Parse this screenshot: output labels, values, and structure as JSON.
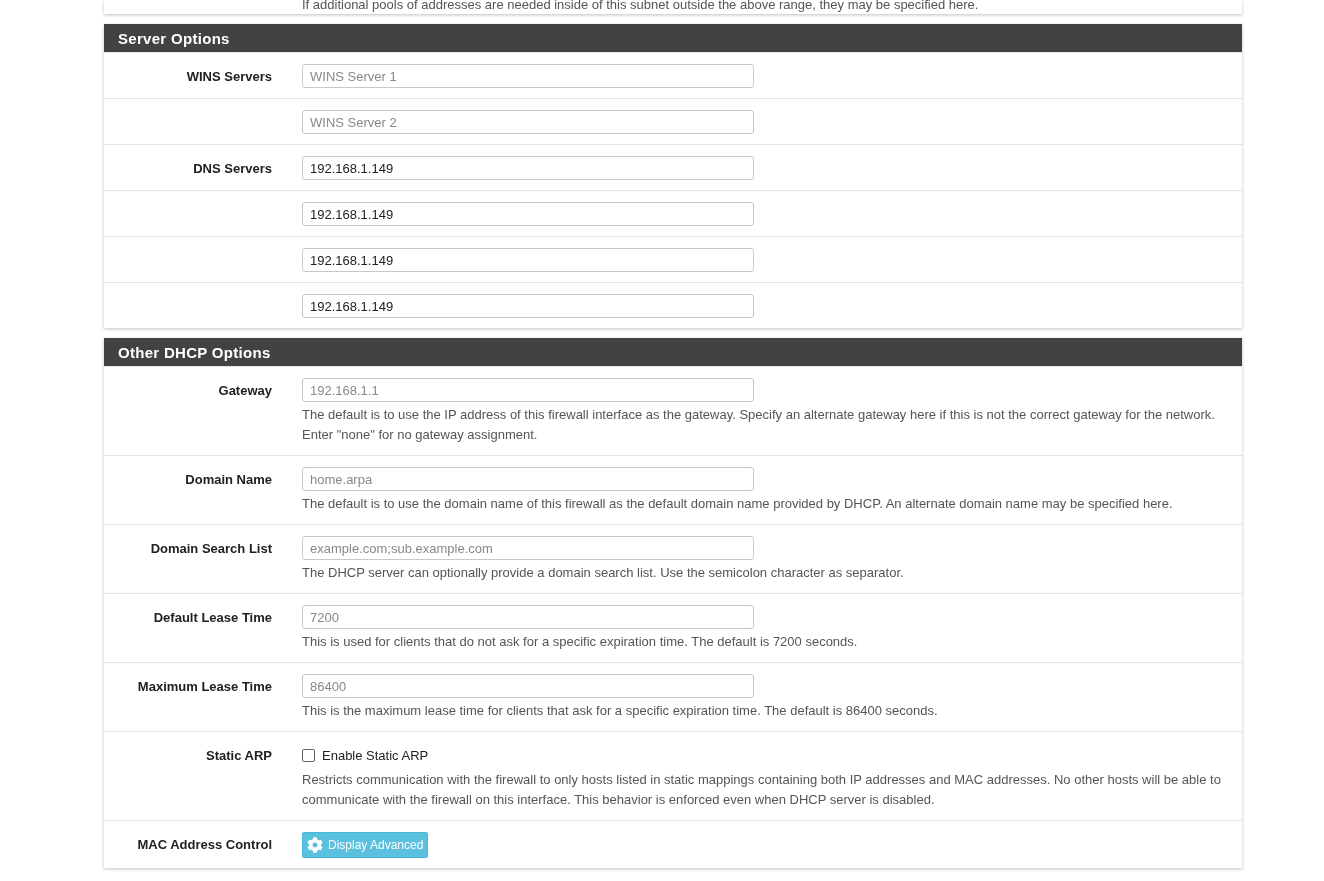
{
  "top_note": "If additional pools of addresses are needed inside of this subnet outside the above range, they may be specified here.",
  "sections": [
    {
      "title": "Server Options",
      "rows": [
        {
          "kind": "input",
          "label": "WINS Servers",
          "placeholder": "WINS Server 1"
        },
        {
          "kind": "input",
          "placeholder": "WINS Server 2"
        },
        {
          "kind": "input",
          "label": "DNS Servers",
          "value": "192.168.1.149"
        },
        {
          "kind": "input",
          "value": "192.168.1.149"
        },
        {
          "kind": "input",
          "value": "192.168.1.149"
        },
        {
          "kind": "input",
          "value": "192.168.1.149"
        }
      ]
    },
    {
      "title": "Other DHCP Options",
      "rows": [
        {
          "kind": "input",
          "label": "Gateway",
          "placeholder": "192.168.1.1",
          "help": "The default is to use the IP address of this firewall interface as the gateway. Specify an alternate gateway here if this is not the correct gateway for the network. Enter \"none\" for no gateway assignment."
        },
        {
          "kind": "input",
          "label": "Domain Name",
          "placeholder": "home.arpa",
          "help": "The default is to use the domain name of this firewall as the default domain name provided by DHCP. An alternate domain name may be specified here."
        },
        {
          "kind": "input",
          "label": "Domain Search List",
          "placeholder": "example.com;sub.example.com",
          "help": "The DHCP server can optionally provide a domain search list. Use the semicolon character as separator."
        },
        {
          "kind": "input",
          "label": "Default Lease Time",
          "placeholder": "7200",
          "help": "This is used for clients that do not ask for a specific expiration time. The default is 7200 seconds."
        },
        {
          "kind": "input",
          "label": "Maximum Lease Time",
          "placeholder": "86400",
          "help": "This is the maximum lease time for clients that ask for a specific expiration time. The default is 86400 seconds."
        },
        {
          "kind": "checkbox",
          "label": "Static ARP",
          "text": "Enable Static ARP",
          "checked": false,
          "help": "Restricts communication with the firewall to only hosts listed in static mappings containing both IP addresses and MAC addresses. No other hosts will be able to communicate with the firewall on this interface. This behavior is enforced even when DHCP server is disabled."
        },
        {
          "kind": "button",
          "label": "MAC Address Control",
          "text": "Display Advanced"
        }
      ]
    }
  ]
}
